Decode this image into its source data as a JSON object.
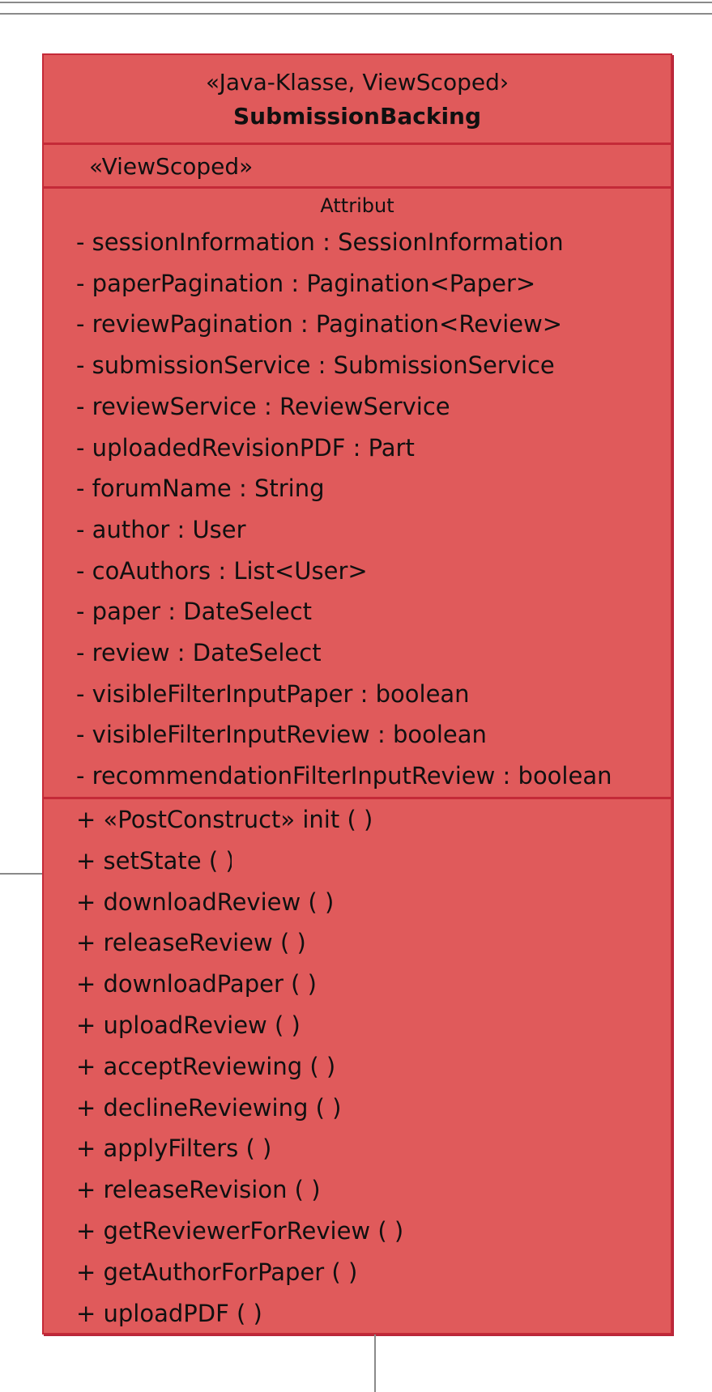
{
  "uml_class": {
    "stereotype": "«Java-Klasse, ViewScoped›",
    "name": "SubmissionBacking",
    "annotation": "«ViewScoped»",
    "attributes_heading": "Attribut",
    "colors": {
      "fill": "#e05a5b",
      "border": "#c42a38",
      "connector": "#8a8a8a"
    },
    "attributes": [
      "- sessionInformation : SessionInformation",
      "- paperPagination : Pagination<Paper>",
      "- reviewPagination : Pagination<Review>",
      "- submissionService : SubmissionService",
      "- reviewService : ReviewService",
      "- uploadedRevisionPDF : Part",
      "- forumName : String",
      "- author : User",
      "- coAuthors : List<User>",
      "- paper : DateSelect",
      "- review : DateSelect",
      "- visibleFilterInputPaper : boolean",
      "- visibleFilterInputReview : boolean",
      "- recommendationFilterInputReview : boolean"
    ],
    "operations": [
      "+ «PostConstruct» init ( )",
      "+ setState ( )",
      "+ downloadReview ( )",
      "+ releaseReview ( )",
      "+ downloadPaper ( )",
      "+ uploadReview ( )",
      "+ acceptReviewing ( )",
      "+ declineReviewing ( )",
      "+ applyFilters ( )",
      "+ releaseRevision ( )",
      "+ getReviewerForReview ( )",
      "+ getAuthorForPaper ( )",
      "+ uploadPDF ( )"
    ]
  }
}
